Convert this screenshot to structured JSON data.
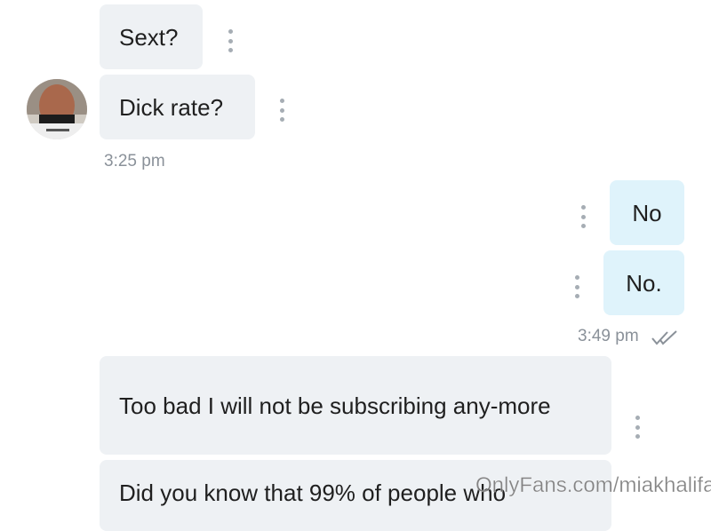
{
  "messages": {
    "incoming_1": "Sext?",
    "incoming_2": "Dick rate?",
    "incoming_time_1": "3:25 pm",
    "outgoing_1": "No",
    "outgoing_2": "No.",
    "outgoing_time": "3:49 pm",
    "incoming_3": "Too bad I will not be subscribing any-more",
    "incoming_4": "Did you know that 99% of people who"
  },
  "icons": {
    "options": "kebab-vertical-icon",
    "read_receipt": "double-check-icon",
    "avatar": "user-avatar-photo"
  },
  "watermark": "OnlyFans.com/miakhalifa",
  "colors": {
    "incoming_bubble": "#eef1f4",
    "outgoing_bubble": "#dff3fb",
    "timestamp": "#8a9199",
    "options_dots": "#a6adb4"
  }
}
